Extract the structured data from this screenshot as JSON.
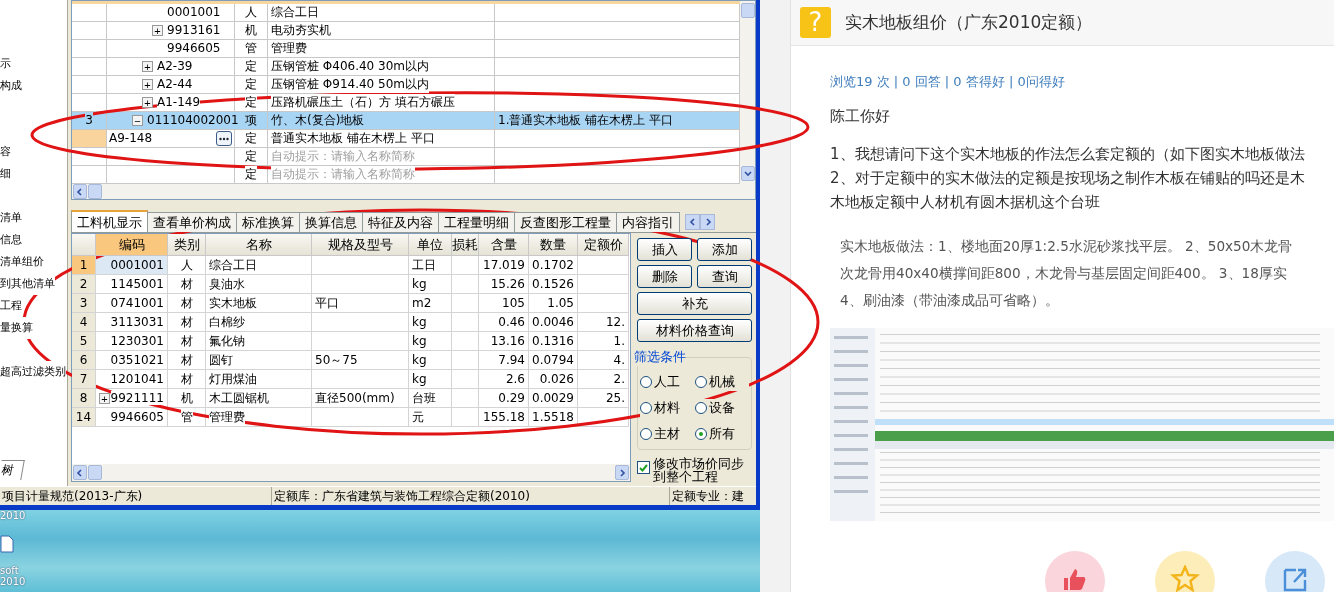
{
  "software": {
    "nav_groups": [
      [
        "示",
        "构成"
      ],
      [
        "容",
        "细"
      ],
      [
        "清单",
        "信息",
        "清单组价",
        "到其他清单",
        "工程",
        "量换算"
      ],
      [
        "超高过滤类别"
      ]
    ],
    "nav_tab": "树",
    "tree_rows": [
      {
        "kind": "resource",
        "code": "0001001",
        "type": "人",
        "name": "综合工日",
        "selected": false
      },
      {
        "kind": "resource",
        "expander": "+",
        "code": "9913161",
        "type": "机",
        "name": "电动夯实机",
        "selected": false
      },
      {
        "kind": "resource",
        "code": "9946605",
        "type": "管",
        "name": "管理费",
        "selected": false
      },
      {
        "kind": "quota",
        "expander": "+",
        "code": "A2-39",
        "type": "定",
        "name": "压钢管桩 Φ406.40 30m以内",
        "selected": false
      },
      {
        "kind": "quota",
        "expander": "+",
        "code": "A2-44",
        "type": "定",
        "name": "压钢管桩 Φ914.40 50m以内",
        "selected": false
      },
      {
        "kind": "quota",
        "expander": "+",
        "code": "A1-149",
        "type": "定",
        "name": "压路机碾压土（石）方 填石方碾压",
        "selected": false
      },
      {
        "kind": "item",
        "number": "3",
        "expander": "−",
        "code": "011104002001",
        "type": "项",
        "name": "竹、木(复合)地板",
        "feature": "1.普通实木地板 铺在木楞上 平口",
        "selected": true
      },
      {
        "kind": "input",
        "code": "A9-148",
        "type": "定",
        "name": "普通实木地板 铺在木楞上 平口",
        "selected": false
      },
      {
        "kind": "hint",
        "type": "定",
        "name": "自动提示：请输入名称简称",
        "selected": false
      },
      {
        "kind": "hint",
        "type": "定",
        "name": "自动提示：请输入名称简称",
        "selected": false
      }
    ],
    "tabs": [
      {
        "label": "工料机显示",
        "selected": true
      },
      {
        "label": "查看单价构成",
        "selected": false
      },
      {
        "label": "标准换算",
        "selected": false
      },
      {
        "label": "换算信息",
        "selected": false
      },
      {
        "label": "特征及内容",
        "selected": false
      },
      {
        "label": "工程量明细",
        "selected": false
      },
      {
        "label": "反查图形工程量",
        "selected": false
      },
      {
        "label": "内容指引",
        "selected": false
      }
    ],
    "columns": [
      {
        "label": "编码",
        "selected": true
      },
      {
        "label": "类别",
        "selected": false
      },
      {
        "label": "名称",
        "selected": false
      },
      {
        "label": "规格及型号",
        "selected": false
      },
      {
        "label": "单位",
        "selected": false
      },
      {
        "label": "损耗",
        "selected": false
      },
      {
        "label": "含量",
        "selected": false
      },
      {
        "label": "数量",
        "selected": false
      },
      {
        "label": "定额价",
        "selected": false
      }
    ],
    "rows": [
      {
        "number": "1",
        "code": "0001001",
        "type": "人",
        "name": "综合工日",
        "unit": "工日",
        "content": "17.019",
        "quantity": "0.1702",
        "selected": true
      },
      {
        "number": "2",
        "code": "1145001",
        "type": "材",
        "name": "臭油水",
        "unit": "kg",
        "content": "15.26",
        "quantity": "0.1526",
        "selected": false
      },
      {
        "number": "3",
        "code": "0741001",
        "type": "材",
        "name": "实木地板",
        "spec": "平口",
        "unit": "m2",
        "content": "105",
        "quantity": "1.05",
        "selected": false
      },
      {
        "number": "4",
        "code": "3113031",
        "type": "材",
        "name": "白棉纱",
        "unit": "kg",
        "content": "0.46",
        "quantity": "0.0046",
        "price": "12.",
        "selected": false
      },
      {
        "number": "5",
        "code": "1230301",
        "type": "材",
        "name": "氟化钠",
        "unit": "kg",
        "content": "13.16",
        "quantity": "0.1316",
        "price": "1.",
        "selected": false
      },
      {
        "number": "6",
        "code": "0351021",
        "type": "材",
        "name": "圆钉",
        "spec": "50～75",
        "unit": "kg",
        "content": "7.94",
        "quantity": "0.0794",
        "price": "4.",
        "selected": false
      },
      {
        "number": "7",
        "code": "1201041",
        "type": "材",
        "name": "灯用煤油",
        "unit": "kg",
        "content": "2.6",
        "quantity": "0.026",
        "price": "2.",
        "selected": false
      },
      {
        "number": "8",
        "expander": "+",
        "code": "9921111",
        "type": "机",
        "name": "木工圆锯机",
        "spec": "直径500(mm)",
        "unit": "台班",
        "content": "0.29",
        "quantity": "0.0029",
        "price": "25.",
        "selected": false
      },
      {
        "number": "14",
        "code": "9946605",
        "type": "管",
        "name": "管理费",
        "unit": "元",
        "content": "155.18",
        "quantity": "1.5518",
        "selected": false
      }
    ],
    "button_rows": [
      [
        "插入",
        "添加"
      ],
      [
        "删除",
        "查询"
      ],
      [
        "补充"
      ],
      [
        "材料价格查询"
      ]
    ],
    "filter": {
      "title": "筛选条件",
      "options": [
        {
          "label": "人工",
          "selected": false
        },
        {
          "label": "机械",
          "selected": false
        },
        {
          "label": "材料",
          "selected": false
        },
        {
          "label": "设备",
          "selected": false
        },
        {
          "label": "主材",
          "selected": false
        },
        {
          "label": "所有",
          "selected": true
        }
      ]
    },
    "sync_checkbox": {
      "label": "修改市场价同步到整个工程",
      "checked": true
    },
    "status_bar": [
      "项目计量规范(2013-广东)",
      "定额库：广东省建筑与装饰工程综合定额(2010)",
      "定额专业：建"
    ]
  },
  "desktop": {
    "labels_above": [
      "2010"
    ],
    "labels_below": [
      "soft",
      "2010"
    ]
  },
  "qa": {
    "icon": "?",
    "title": "实木地板组价（广东2010定额）",
    "stats": "浏览19 次 | 0 回答 | 0 答得好 | 0问得好",
    "greeting": "陈工你好",
    "question_lines": [
      "1、我想请问下这个实木地板的作法怎么套定额的（如下图实木地板做法",
      "2、对于定额中的实木做法的定额是按现场之制作木板在铺贴的吗还是木",
      "木地板定额中人材机有圆木据机这个台班"
    ],
    "quote_lines": [
      "实木地板做法：1、楼地面20厚1:2.5水泥砂浆找平层。 2、50x50木龙骨",
      "次龙骨用40x40横撑间距800，木龙骨与基层固定间距400。 3、18厚实",
      "4、刷油漆（带油漆成品可省略）。"
    ],
    "actions": [
      {
        "kind": "like"
      },
      {
        "kind": "favorite"
      },
      {
        "kind": "share"
      }
    ]
  }
}
